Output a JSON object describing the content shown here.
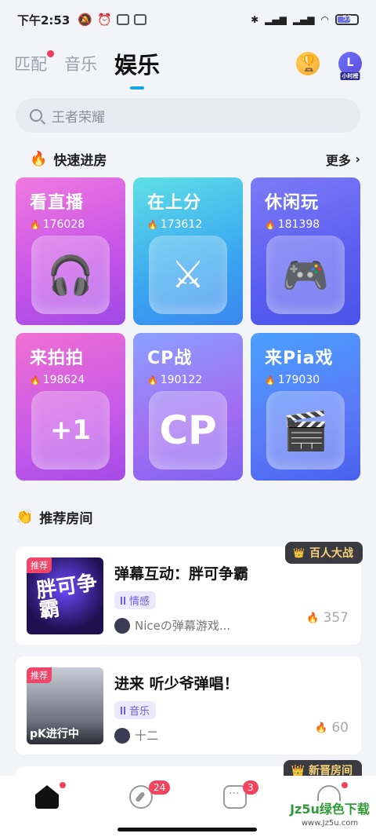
{
  "status_bar": {
    "time": "下午2:53",
    "battery": "57"
  },
  "tabs": [
    {
      "label": "匹配",
      "dot": true
    },
    {
      "label": "音乐",
      "dot": false
    },
    {
      "label": "娱乐",
      "active": true
    }
  ],
  "header": {
    "clock_tag": "小时榜",
    "clock_letter": "L"
  },
  "search": {
    "placeholder": "王者荣耀"
  },
  "quick": {
    "title": "快速进房",
    "more": "更多"
  },
  "rooms": [
    {
      "title": "看直播",
      "count": "176028",
      "icon": "headphones"
    },
    {
      "title": "在上分",
      "count": "173612",
      "icon": "crossed-swords"
    },
    {
      "title": "休闲玩",
      "count": "181398",
      "icon": "gamepad"
    },
    {
      "title": "来拍拍",
      "count": "198624",
      "icon": "plus-one"
    },
    {
      "title": "CP战",
      "count": "190122",
      "icon": "cp"
    },
    {
      "title": "来Pia戏",
      "count": "179030",
      "icon": "clapperboard"
    }
  ],
  "recommend": {
    "title": "推荐房间",
    "items": [
      {
        "tag": "推荐",
        "thumb_text": "胖可争霸",
        "name": "弹幕互动：胖可争霸",
        "category": "情感",
        "owner": "Niceの弹幕游戏...",
        "heat": "357",
        "ribbon": "百人大战"
      },
      {
        "tag": "推荐",
        "thumb_text": "pK进行中",
        "name": "进来 听少爷弹唱！",
        "category": "音乐",
        "owner": "十二",
        "heat": "60"
      }
    ],
    "peek_ribbon": "新晋房间"
  },
  "nav": {
    "discover_badge": "24",
    "message_badge": "3"
  },
  "watermark": {
    "line1": "Jz5u绿色下载",
    "line2": "www.Jz5u.com"
  }
}
